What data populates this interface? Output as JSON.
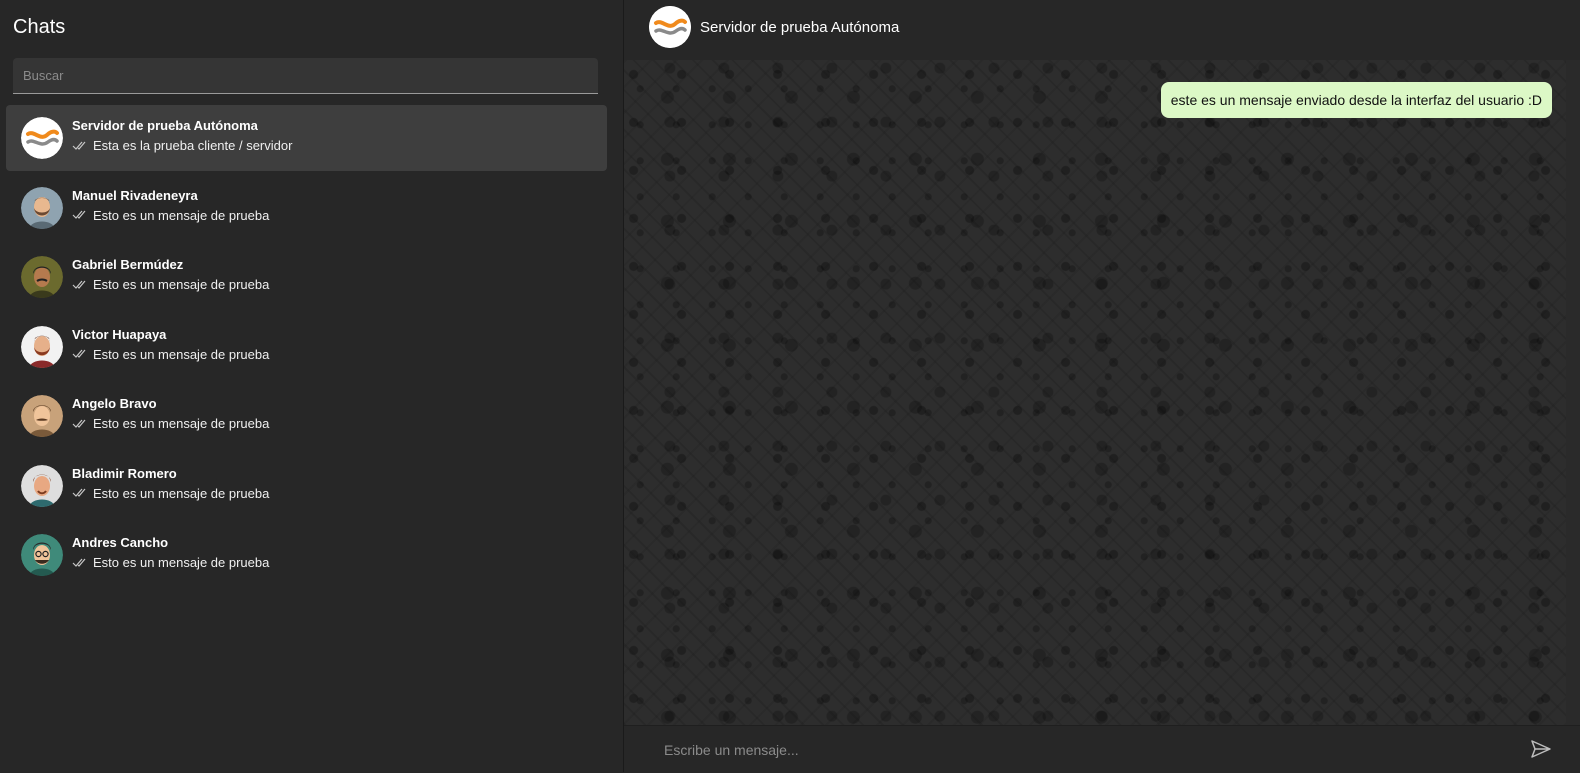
{
  "sidebar": {
    "title": "Chats",
    "search_placeholder": "Buscar",
    "chats": [
      {
        "name": "Servidor de prueba Autónoma",
        "preview": "Esta es la prueba cliente / servidor",
        "avatar": "brand-logo",
        "active": true
      },
      {
        "name": "Manuel Rivadeneyra",
        "preview": "Esto es un mensaje de prueba",
        "avatar": "man-beard-gray-bg"
      },
      {
        "name": "Gabriel Bermúdez",
        "preview": "Esto es un mensaje de prueba",
        "avatar": "man-olive-bg"
      },
      {
        "name": "Victor Huapaya",
        "preview": "Esto es un mensaje de prueba",
        "avatar": "man-red-beard"
      },
      {
        "name": "Angelo Bravo",
        "preview": "Esto es un mensaje de prueba",
        "avatar": "man-mustache-tan-bg"
      },
      {
        "name": "Bladimir Romero",
        "preview": "Esto es un mensaje de prueba",
        "avatar": "man-goatee"
      },
      {
        "name": "Andres Cancho",
        "preview": "Esto es un mensaje de prueba",
        "avatar": "man-glasses-teal-bg"
      }
    ]
  },
  "conversation": {
    "title": "Servidor de prueba Autónoma",
    "messages": [
      {
        "text": "este es un mensaje enviado desde la interfaz del usuario :D",
        "outgoing": true
      }
    ],
    "composer_placeholder": "Escribe un mensaje...",
    "send_icon": "send-icon"
  },
  "colors": {
    "background": "#262626",
    "active_chat": "#3e3e3e",
    "outgoing_bubble": "#dcf8c6"
  }
}
